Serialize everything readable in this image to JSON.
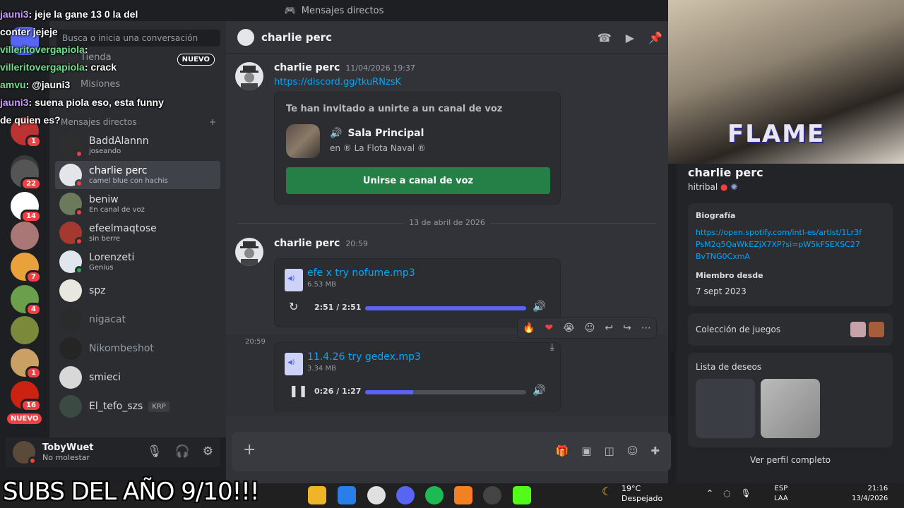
{
  "titlebar": {
    "title": "Mensajes directos"
  },
  "rail": {
    "badges": [
      "1",
      "1",
      "22",
      "14",
      "7",
      "4",
      "1",
      "16"
    ],
    "nuevo": "NUEVO"
  },
  "sidebar": {
    "search_placeholder": "Busca o inicia una conversación",
    "tienda": "Tienda",
    "tienda_badge": "NUEVO",
    "nitro": "Misiones",
    "dm_header": "Mensajes directos",
    "dms": [
      {
        "name": "BaddAlannn",
        "sub": "joseando"
      },
      {
        "name": "charlie perc",
        "sub": "camel blue con hachis"
      },
      {
        "name": "beniw",
        "sub": "En canal de voz"
      },
      {
        "name": "efeelmaqtose",
        "sub": "sin berre"
      },
      {
        "name": "Lorenzeti",
        "sub": "Genius"
      },
      {
        "name": "spz",
        "sub": ""
      },
      {
        "name": "nigacat",
        "sub": ""
      },
      {
        "name": "Nikombeshot",
        "sub": ""
      },
      {
        "name": "smieci",
        "sub": ""
      },
      {
        "name": "El_tefo_szs",
        "sub": "KRP"
      }
    ]
  },
  "user": {
    "name": "TobyWuet",
    "status": "No molestar"
  },
  "chat": {
    "header": "charlie perc",
    "msg1": {
      "author": "charlie perc",
      "time": "11/04/2026 19:37",
      "link": "https://discord.gg/tkuRNzsK"
    },
    "invite": {
      "heading": "Te han invitado a unirte a un canal de voz",
      "channel": "Sala Principal",
      "guild": "en ® La Flota Naval ®",
      "button": "Unirse a canal de voz"
    },
    "divider": "13 de abril de 2026",
    "msg2": {
      "author": "charlie perc",
      "time": "20:59"
    },
    "audio1": {
      "name": "efe x try nofume.mp3",
      "size": "6.53 MB",
      "time": "2:51 / 2:51",
      "progress": 1.0
    },
    "side_time": "20:59",
    "audio2": {
      "name": "11.4.26 try gedex.mp3",
      "size": "3.34 MB",
      "time": "0:26 / 1:27",
      "progress": 0.3
    }
  },
  "profile": {
    "name": "charlie perc",
    "handle": "hitribal",
    "bio_label": "Biografía",
    "bio_link": "https://open.spotify.com/intl-es/artist/1Lr3fPsM2q5QaWkEZjX7XP?si=pW5kFSEXSC27BvTNG0CxmA",
    "member_label": "Miembro desde",
    "member_since": "7 sept 2023",
    "games_label": "Colección de juegos",
    "wishlist_label": "Lista de deseos",
    "view_full": "Ver perfil completo"
  },
  "overlay": {
    "lines": [
      {
        "user": "jauni3",
        "text": "jeje la gane 13 0 la del"
      },
      {
        "user": "",
        "text": "conter jejeje"
      },
      {
        "user": "villeritovergapiola",
        "text": ""
      },
      {
        "user": "villeritovergapiola",
        "text": "crack"
      },
      {
        "user": "amvu",
        "text": "@jauni3"
      },
      {
        "user": "jauni3",
        "text": "suena piola eso, esta funny"
      },
      {
        "user": "",
        "text": "de quien es?"
      }
    ],
    "flame": "FLAME",
    "subs": "SUBS DEL AÑO 9/10!!!"
  },
  "taskbar": {
    "temp": "19°C",
    "weather": "Despejado",
    "lang1": "ESP",
    "lang2": "LAA",
    "time": "21:16",
    "date": "13/4/2026"
  },
  "colors": {
    "accent": "#5865f2",
    "green": "#248046",
    "link": "#00a8fc",
    "danger": "#f23f43"
  }
}
